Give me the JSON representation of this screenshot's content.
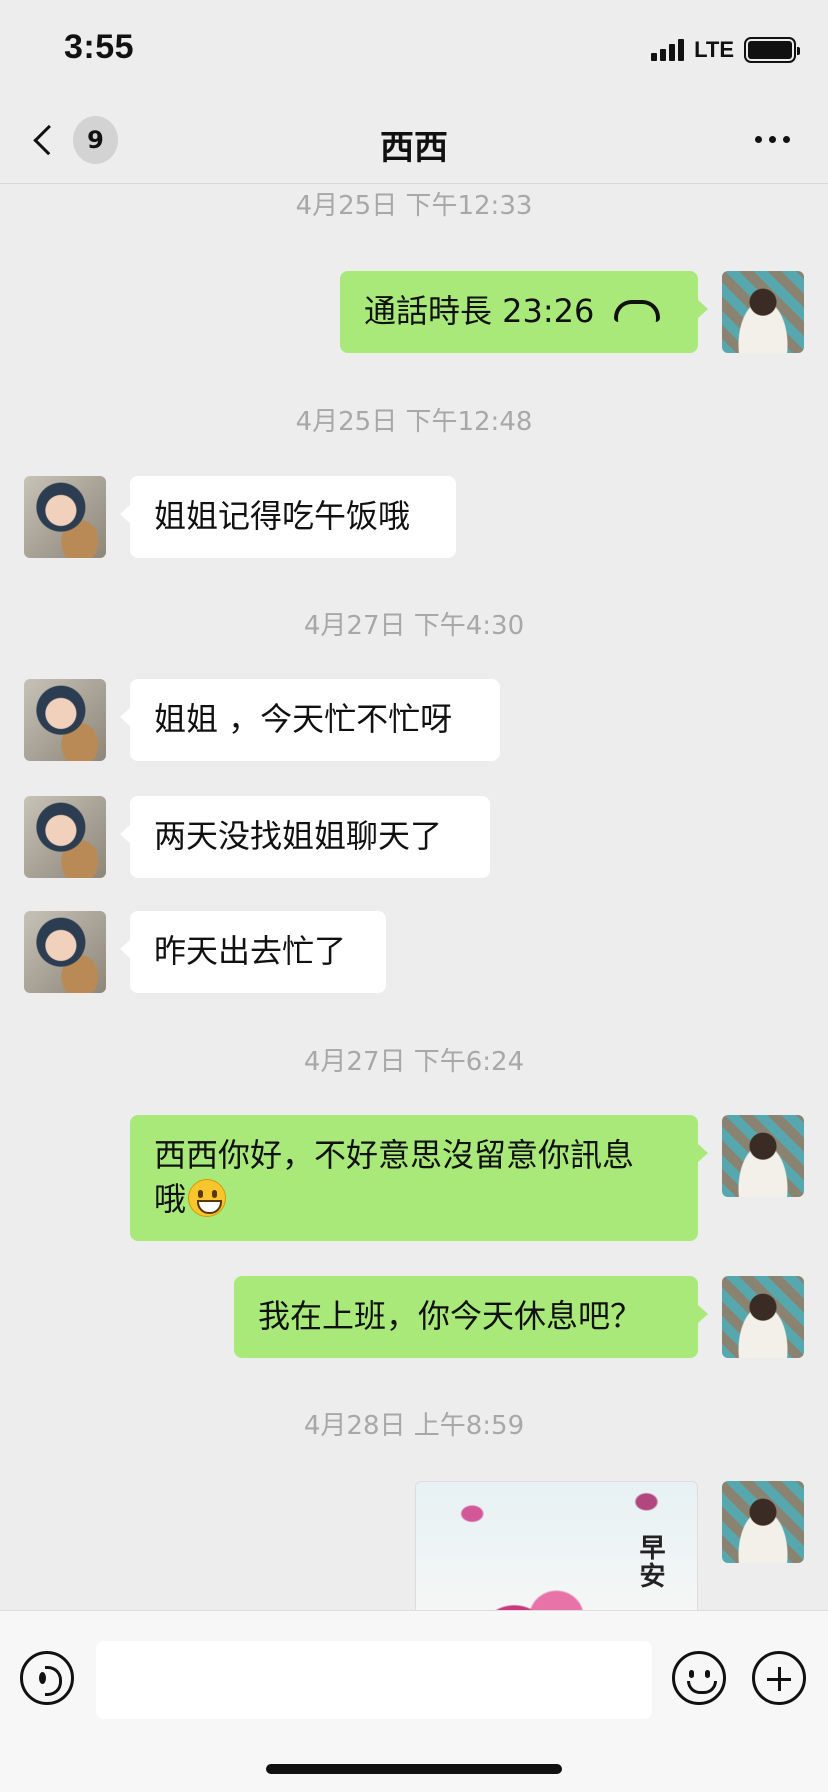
{
  "status_bar": {
    "time": "3:55",
    "network": "LTE"
  },
  "nav": {
    "unread_count": "9",
    "title": "西西"
  },
  "messages": [
    {
      "timestamp": "4月25日 下午12:33"
    },
    {
      "call_text": "通話時長 23:26"
    },
    {
      "timestamp": "4月25日 下午12:48"
    },
    {
      "text": "姐姐记得吃午饭哦"
    },
    {
      "timestamp": "4月27日 下午4:30"
    },
    {
      "text": "姐姐 ，今天忙不忙呀"
    },
    {
      "text": "两天没找姐姐聊天了"
    },
    {
      "text": "昨天出去忙了"
    },
    {
      "timestamp": "4月27日 下午6:24"
    },
    {
      "text_line1": "西西你好，不好意思沒留意你訊息",
      "text_line2": "哦"
    },
    {
      "text": "我在上班，你今天休息吧？"
    },
    {
      "timestamp": "4月28日 上午8:59"
    },
    {
      "image_caption": "早安"
    }
  ],
  "icons": {
    "back": "chevron-left-icon",
    "more": "ellipsis-icon",
    "call": "phone-hangup-icon",
    "emoji_in_message": "grinning-face-icon",
    "voice": "voice-icon",
    "emoji": "emoji-icon",
    "plus": "plus-icon"
  },
  "colors": {
    "outgoing_bubble": "#a9e97a",
    "incoming_bubble": "#ffffff",
    "background": "#ededed"
  }
}
